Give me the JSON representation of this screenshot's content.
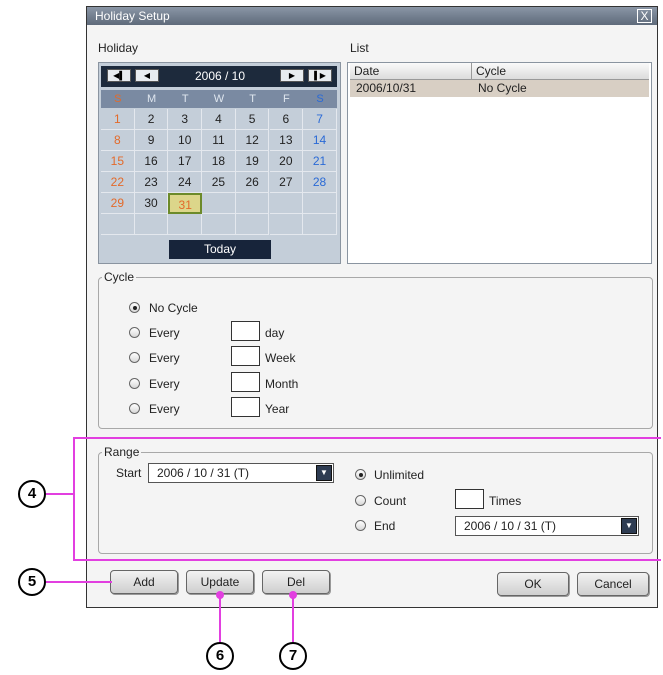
{
  "window": {
    "title": "Holiday Setup",
    "close": "X"
  },
  "holiday": {
    "label": "Holiday",
    "month": "2006 / 10",
    "nav": [
      "◀▌",
      "◀",
      "▶",
      "▌▶"
    ],
    "weekdays": [
      "S",
      "M",
      "T",
      "W",
      "T",
      "F",
      "S"
    ],
    "weeks": [
      [
        "1",
        "2",
        "3",
        "4",
        "5",
        "6",
        "7"
      ],
      [
        "8",
        "9",
        "10",
        "11",
        "12",
        "13",
        "14"
      ],
      [
        "15",
        "16",
        "17",
        "18",
        "19",
        "20",
        "21"
      ],
      [
        "22",
        "23",
        "24",
        "25",
        "26",
        "27",
        "28"
      ],
      [
        "29",
        "30",
        "31",
        "",
        "",
        "",
        ""
      ],
      [
        "",
        "",
        "",
        "",
        "",
        "",
        ""
      ]
    ],
    "selected": "31",
    "today": "Today"
  },
  "list": {
    "label": "List",
    "columns": [
      "Date",
      "Cycle"
    ],
    "rows": [
      {
        "date": "2006/10/31",
        "cycle": "No Cycle"
      }
    ]
  },
  "cycle": {
    "legend": "Cycle",
    "options": [
      {
        "label": "No Cycle",
        "unit": "",
        "selected": true
      },
      {
        "label": "Every",
        "unit": "day",
        "selected": false
      },
      {
        "label": "Every",
        "unit": "Week",
        "selected": false
      },
      {
        "label": "Every",
        "unit": "Month",
        "selected": false
      },
      {
        "label": "Every",
        "unit": "Year",
        "selected": false
      }
    ]
  },
  "range": {
    "legend": "Range",
    "start_label": "Start",
    "start_value": "2006  / 10 / 31   (T)",
    "unlimited": "Unlimited",
    "count": "Count",
    "times": "Times",
    "end": "End",
    "end_value": "2006  / 10 / 31   (T)"
  },
  "buttons": {
    "add": "Add",
    "update": "Update",
    "del": "Del",
    "ok": "OK",
    "cancel": "Cancel"
  },
  "callouts": {
    "c4": "4",
    "c5": "5",
    "c6": "6",
    "c7": "7"
  },
  "colors": {
    "callout_line": "#e23fe0",
    "sunday": "#e36a2a",
    "saturday": "#2a6ad6",
    "selected_row": "#d8cfc4"
  }
}
